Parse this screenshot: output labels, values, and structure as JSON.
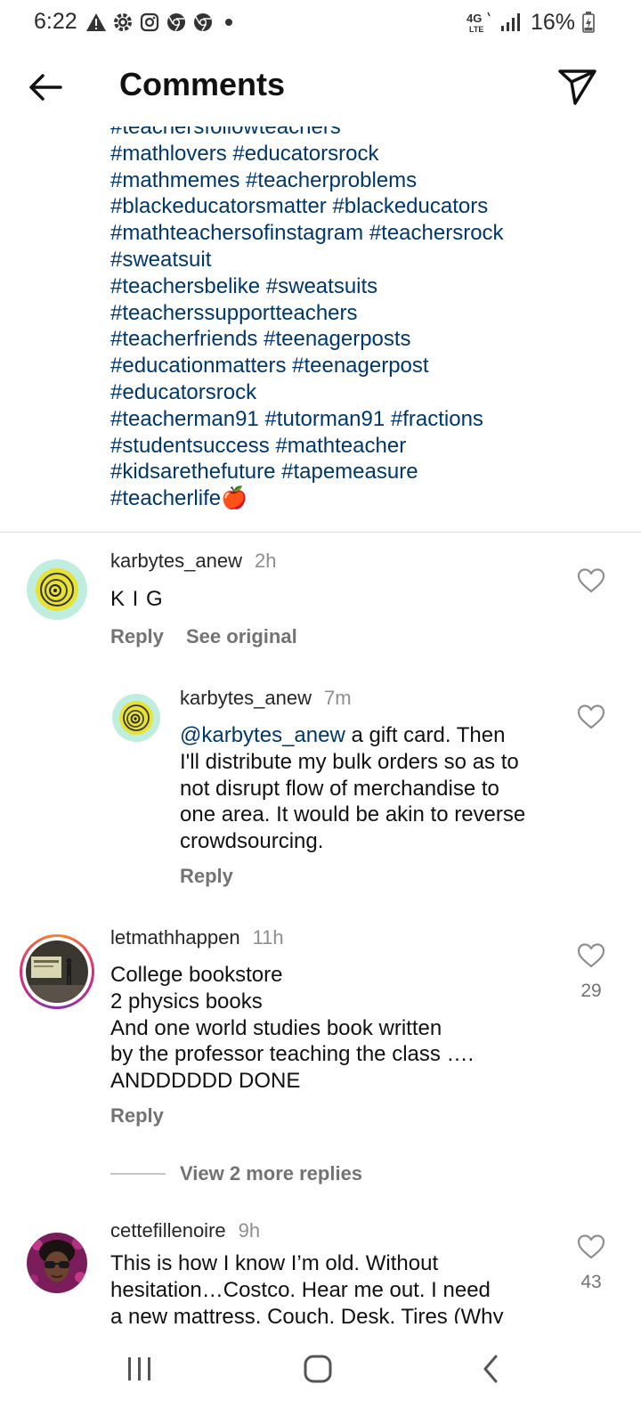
{
  "status_bar": {
    "time": "6:22",
    "network": "4G LTE",
    "battery": "16%",
    "icons": [
      "alert-icon",
      "settings-icon",
      "instagram-icon",
      "chrome-icon",
      "chrome-icon",
      "dot-icon"
    ]
  },
  "header": {
    "title": "Comments",
    "back_icon": "arrow-left-icon",
    "share_icon": "send-icon"
  },
  "caption": {
    "hashtags": [
      "#teachersfollowteachers",
      "#mathlovers #educatorsrock",
      "#mathmemes #teacherproblems",
      "#blackeducatorsmatter #blackeducators",
      "#mathteachersofinstagram #teachersrock",
      "#sweatsuit",
      "#teachersbelike #sweatsuits",
      "#teacherssupportteachers",
      "#teacherfriends #teenagerposts",
      "#educationmatters #teenagerpost",
      "#educatorsrock",
      "#teacherman91 #tutorman91 #fractions",
      "#studentsuccess #mathteacher",
      "#kidsarethefuture #tapemeasure",
      "#teacherlife🍎"
    ]
  },
  "comments": [
    {
      "username": "karbytes_anew",
      "time": "2h",
      "text": "K I G",
      "reply_label": "Reply",
      "see_original_label": "See original",
      "replies": [
        {
          "username": "karbytes_anew",
          "time": "7m",
          "mention": "@karbytes_anew",
          "text_lines": [
            " a gift card. Then",
            "I'll distribute my bulk orders so as to",
            "not disrupt flow of merchandise to",
            "one area. It would be akin to reverse",
            "crowdsourcing."
          ],
          "reply_label": "Reply"
        }
      ]
    },
    {
      "username": "letmathhappen",
      "time": "11h",
      "text_lines": [
        "College bookstore",
        "2 physics books",
        "And one world studies book written",
        "by the professor teaching the class ….",
        "ANDDDDDD DONE"
      ],
      "likes": "29",
      "reply_label": "Reply",
      "view_more_label": "View 2 more replies"
    },
    {
      "username": "cettefillenoire",
      "time": "9h",
      "text_lines": [
        "This is how I know I’m old. Without",
        "hesitation…Costco. Hear me out. I need",
        "a new mattress. Couch. Desk. Tires (Why"
      ],
      "likes": "43"
    }
  ],
  "nav_bar": {
    "icons": [
      "recent-apps-icon",
      "home-icon",
      "back-icon"
    ]
  }
}
